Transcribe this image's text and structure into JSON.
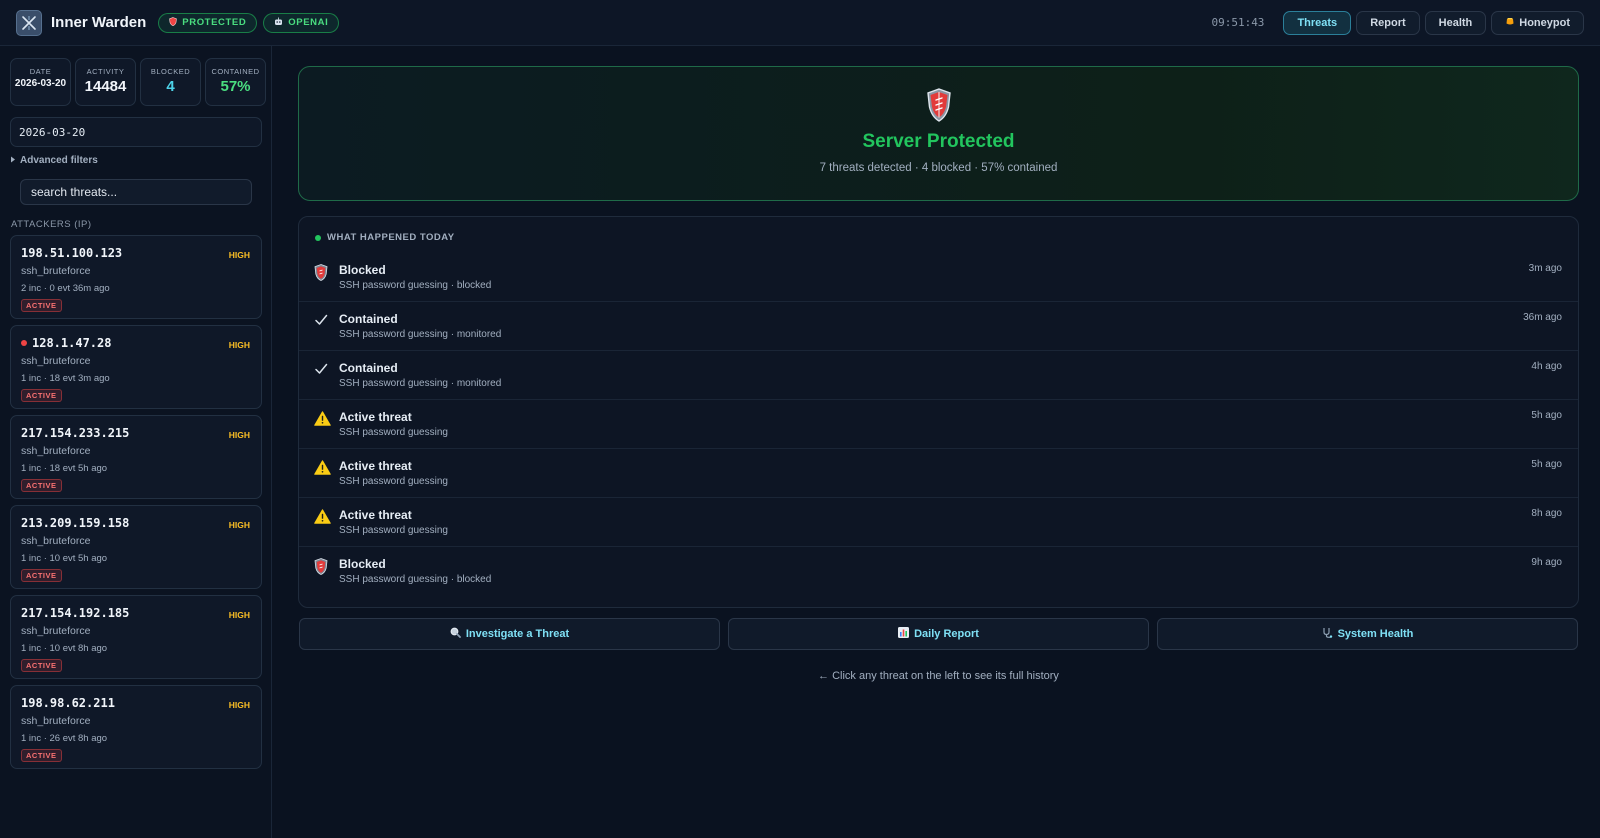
{
  "header": {
    "app_title": "Inner Warden",
    "status_pill": "PROTECTED",
    "ai_pill": "OPENAI",
    "clock": "09:51:43",
    "nav": [
      {
        "label": "Threats",
        "active": true
      },
      {
        "label": "Report",
        "active": false
      },
      {
        "label": "Health",
        "active": false
      },
      {
        "label": "Honeypot",
        "active": false,
        "icon": "honeypot-icon"
      }
    ]
  },
  "sidebar": {
    "stats": [
      {
        "label": "DATE",
        "value": "2026-03-20"
      },
      {
        "label": "ACTIVITY",
        "value": "14484"
      },
      {
        "label": "BLOCKED",
        "value": "4"
      },
      {
        "label": "CONTAINED",
        "value": "57%"
      }
    ],
    "date_value": "2026-03-20",
    "advanced_filters": "Advanced filters",
    "search_placeholder": "search threats...",
    "section_title": "ATTACKERS (IP)",
    "attackers": [
      {
        "ip": "198.51.100.123",
        "severity": "HIGH",
        "type": "ssh_bruteforce",
        "meta": "2 inc · 0 evt 36m ago",
        "status": "ACTIVE",
        "live": false
      },
      {
        "ip": "128.1.47.28",
        "severity": "HIGH",
        "type": "ssh_bruteforce",
        "meta": "1 inc · 18 evt 3m ago",
        "status": "ACTIVE",
        "live": true
      },
      {
        "ip": "217.154.233.215",
        "severity": "HIGH",
        "type": "ssh_bruteforce",
        "meta": "1 inc · 18 evt 5h ago",
        "status": "ACTIVE",
        "live": false
      },
      {
        "ip": "213.209.159.158",
        "severity": "HIGH",
        "type": "ssh_bruteforce",
        "meta": "1 inc · 10 evt 5h ago",
        "status": "ACTIVE",
        "live": false
      },
      {
        "ip": "217.154.192.185",
        "severity": "HIGH",
        "type": "ssh_bruteforce",
        "meta": "1 inc · 10 evt 8h ago",
        "status": "ACTIVE",
        "live": false
      },
      {
        "ip": "198.98.62.211",
        "severity": "HIGH",
        "type": "ssh_bruteforce",
        "meta": "1 inc · 26 evt 8h ago",
        "status": "ACTIVE",
        "live": false
      }
    ]
  },
  "hero": {
    "title": "Server Protected",
    "subtitle": "7 threats detected · 4 blocked · 57% contained"
  },
  "activity": {
    "heading": "WHAT HAPPENED TODAY",
    "events": [
      {
        "kind": "blocked",
        "title": "Blocked",
        "detail": "SSH password guessing · blocked",
        "time": "3m ago"
      },
      {
        "kind": "contained",
        "title": "Contained",
        "detail": "SSH password guessing · monitored",
        "time": "36m ago"
      },
      {
        "kind": "contained",
        "title": "Contained",
        "detail": "SSH password guessing · monitored",
        "time": "4h ago"
      },
      {
        "kind": "active",
        "title": "Active threat",
        "detail": "SSH password guessing",
        "time": "5h ago"
      },
      {
        "kind": "active",
        "title": "Active threat",
        "detail": "SSH password guessing",
        "time": "5h ago"
      },
      {
        "kind": "active",
        "title": "Active threat",
        "detail": "SSH password guessing",
        "time": "8h ago"
      },
      {
        "kind": "blocked",
        "title": "Blocked",
        "detail": "SSH password guessing · blocked",
        "time": "9h ago"
      }
    ]
  },
  "actions": [
    {
      "label": "Investigate a Threat",
      "icon": "magnifier-icon"
    },
    {
      "label": "Daily Report",
      "icon": "bar-chart-icon"
    },
    {
      "label": "System Health",
      "icon": "stethoscope-icon"
    }
  ],
  "hint": "← Click any threat on the left to see its full history",
  "colors": {
    "accent_cyan": "#7fe0f5",
    "protected_green": "#22c55e",
    "severity_high": "#fbbf24",
    "active_red": "#ef4444",
    "warning_yellow": "#facc15"
  }
}
